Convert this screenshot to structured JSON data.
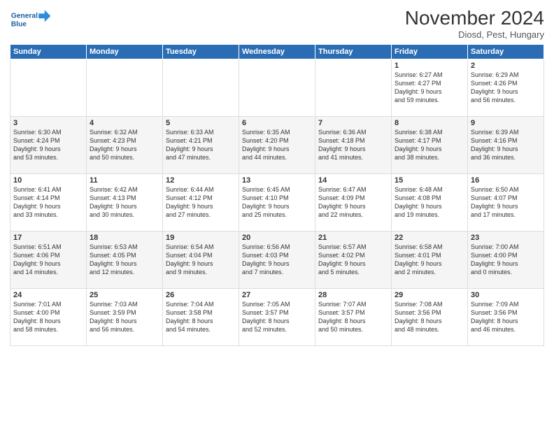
{
  "logo": {
    "line1": "General",
    "line2": "Blue"
  },
  "title": "November 2024",
  "subtitle": "Diosd, Pest, Hungary",
  "days_header": [
    "Sunday",
    "Monday",
    "Tuesday",
    "Wednesday",
    "Thursday",
    "Friday",
    "Saturday"
  ],
  "weeks": [
    [
      {
        "num": "",
        "info": ""
      },
      {
        "num": "",
        "info": ""
      },
      {
        "num": "",
        "info": ""
      },
      {
        "num": "",
        "info": ""
      },
      {
        "num": "",
        "info": ""
      },
      {
        "num": "1",
        "info": "Sunrise: 6:27 AM\nSunset: 4:27 PM\nDaylight: 9 hours\nand 59 minutes."
      },
      {
        "num": "2",
        "info": "Sunrise: 6:29 AM\nSunset: 4:26 PM\nDaylight: 9 hours\nand 56 minutes."
      }
    ],
    [
      {
        "num": "3",
        "info": "Sunrise: 6:30 AM\nSunset: 4:24 PM\nDaylight: 9 hours\nand 53 minutes."
      },
      {
        "num": "4",
        "info": "Sunrise: 6:32 AM\nSunset: 4:23 PM\nDaylight: 9 hours\nand 50 minutes."
      },
      {
        "num": "5",
        "info": "Sunrise: 6:33 AM\nSunset: 4:21 PM\nDaylight: 9 hours\nand 47 minutes."
      },
      {
        "num": "6",
        "info": "Sunrise: 6:35 AM\nSunset: 4:20 PM\nDaylight: 9 hours\nand 44 minutes."
      },
      {
        "num": "7",
        "info": "Sunrise: 6:36 AM\nSunset: 4:18 PM\nDaylight: 9 hours\nand 41 minutes."
      },
      {
        "num": "8",
        "info": "Sunrise: 6:38 AM\nSunset: 4:17 PM\nDaylight: 9 hours\nand 38 minutes."
      },
      {
        "num": "9",
        "info": "Sunrise: 6:39 AM\nSunset: 4:16 PM\nDaylight: 9 hours\nand 36 minutes."
      }
    ],
    [
      {
        "num": "10",
        "info": "Sunrise: 6:41 AM\nSunset: 4:14 PM\nDaylight: 9 hours\nand 33 minutes."
      },
      {
        "num": "11",
        "info": "Sunrise: 6:42 AM\nSunset: 4:13 PM\nDaylight: 9 hours\nand 30 minutes."
      },
      {
        "num": "12",
        "info": "Sunrise: 6:44 AM\nSunset: 4:12 PM\nDaylight: 9 hours\nand 27 minutes."
      },
      {
        "num": "13",
        "info": "Sunrise: 6:45 AM\nSunset: 4:10 PM\nDaylight: 9 hours\nand 25 minutes."
      },
      {
        "num": "14",
        "info": "Sunrise: 6:47 AM\nSunset: 4:09 PM\nDaylight: 9 hours\nand 22 minutes."
      },
      {
        "num": "15",
        "info": "Sunrise: 6:48 AM\nSunset: 4:08 PM\nDaylight: 9 hours\nand 19 minutes."
      },
      {
        "num": "16",
        "info": "Sunrise: 6:50 AM\nSunset: 4:07 PM\nDaylight: 9 hours\nand 17 minutes."
      }
    ],
    [
      {
        "num": "17",
        "info": "Sunrise: 6:51 AM\nSunset: 4:06 PM\nDaylight: 9 hours\nand 14 minutes."
      },
      {
        "num": "18",
        "info": "Sunrise: 6:53 AM\nSunset: 4:05 PM\nDaylight: 9 hours\nand 12 minutes."
      },
      {
        "num": "19",
        "info": "Sunrise: 6:54 AM\nSunset: 4:04 PM\nDaylight: 9 hours\nand 9 minutes."
      },
      {
        "num": "20",
        "info": "Sunrise: 6:56 AM\nSunset: 4:03 PM\nDaylight: 9 hours\nand 7 minutes."
      },
      {
        "num": "21",
        "info": "Sunrise: 6:57 AM\nSunset: 4:02 PM\nDaylight: 9 hours\nand 5 minutes."
      },
      {
        "num": "22",
        "info": "Sunrise: 6:58 AM\nSunset: 4:01 PM\nDaylight: 9 hours\nand 2 minutes."
      },
      {
        "num": "23",
        "info": "Sunrise: 7:00 AM\nSunset: 4:00 PM\nDaylight: 9 hours\nand 0 minutes."
      }
    ],
    [
      {
        "num": "24",
        "info": "Sunrise: 7:01 AM\nSunset: 4:00 PM\nDaylight: 8 hours\nand 58 minutes."
      },
      {
        "num": "25",
        "info": "Sunrise: 7:03 AM\nSunset: 3:59 PM\nDaylight: 8 hours\nand 56 minutes."
      },
      {
        "num": "26",
        "info": "Sunrise: 7:04 AM\nSunset: 3:58 PM\nDaylight: 8 hours\nand 54 minutes."
      },
      {
        "num": "27",
        "info": "Sunrise: 7:05 AM\nSunset: 3:57 PM\nDaylight: 8 hours\nand 52 minutes."
      },
      {
        "num": "28",
        "info": "Sunrise: 7:07 AM\nSunset: 3:57 PM\nDaylight: 8 hours\nand 50 minutes."
      },
      {
        "num": "29",
        "info": "Sunrise: 7:08 AM\nSunset: 3:56 PM\nDaylight: 8 hours\nand 48 minutes."
      },
      {
        "num": "30",
        "info": "Sunrise: 7:09 AM\nSunset: 3:56 PM\nDaylight: 8 hours\nand 46 minutes."
      }
    ]
  ]
}
